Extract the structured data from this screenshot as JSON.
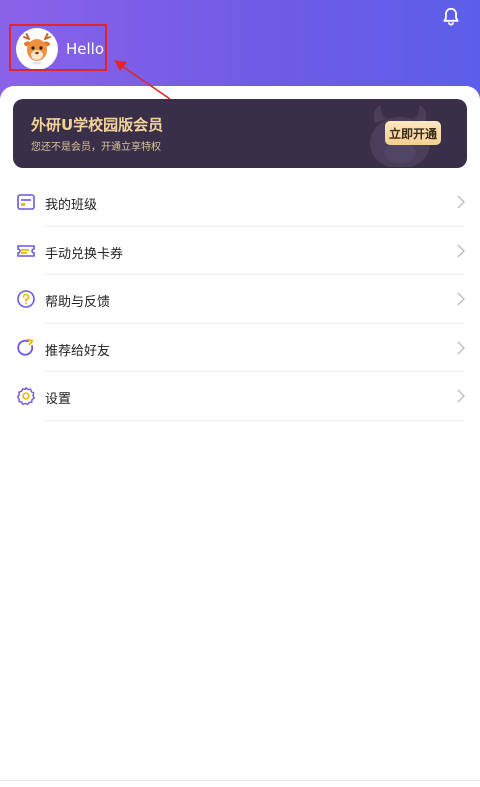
{
  "header": {
    "greeting": "Hello"
  },
  "vip": {
    "title": "外研U学校园版会员",
    "subtitle": "您还不是会员，开通立享特权",
    "button_label": "立即开通"
  },
  "menu": {
    "items": [
      {
        "label": "我的班级",
        "icon": "class-icon"
      },
      {
        "label": "手动兑换卡券",
        "icon": "coupon-icon"
      },
      {
        "label": "帮助与反馈",
        "icon": "help-icon"
      },
      {
        "label": "推荐给好友",
        "icon": "share-icon"
      },
      {
        "label": "设置",
        "icon": "settings-icon"
      }
    ]
  },
  "colors": {
    "header_start": "#8a62e8",
    "header_end": "#5c5ee9",
    "vip_background": "#3a2f48",
    "vip_text": "#f4d39a",
    "icon_purple": "#6a5ae0",
    "icon_yellow": "#f5b800",
    "annotation_red": "#e0262a"
  }
}
